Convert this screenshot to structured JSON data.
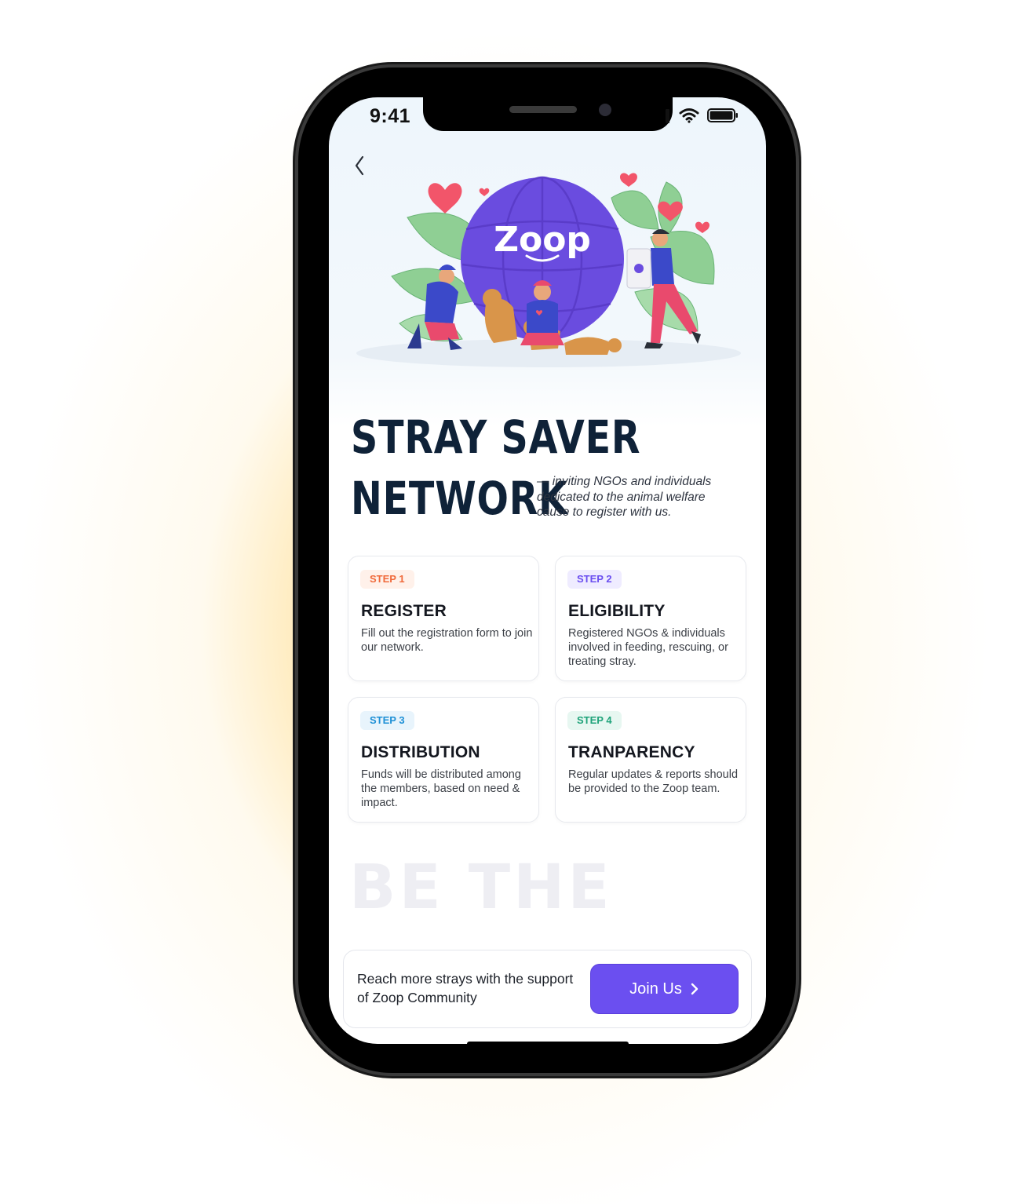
{
  "status_bar": {
    "time": "9:41"
  },
  "hero": {
    "brand_logo": "Zoop"
  },
  "heading": {
    "line1": "STRAY  SAVER",
    "line2": "NETWORK",
    "subtitle": "— inviting NGOs and individuals dedicated to the animal welfare cause to register with us."
  },
  "steps": [
    {
      "badge": "STEP 1",
      "title": "REGISTER",
      "text": "Fill out the registration form to join our network.",
      "badge_color": "#f06a3b",
      "badge_bg": "#fff1ea"
    },
    {
      "badge": "STEP 2",
      "title": "ELIGIBILITY",
      "text": "Registered NGOs & individuals involved in feeding, rescuing, or treating stray.",
      "badge_color": "#6b4ff0",
      "badge_bg": "#efecff"
    },
    {
      "badge": "STEP 3",
      "title": "DISTRIBUTION",
      "text": "Funds will be distributed among the members, based on need & impact.",
      "badge_color": "#1e90d6",
      "badge_bg": "#e8f4fc"
    },
    {
      "badge": "STEP 4",
      "title": "TRANPARENCY",
      "text": "Regular updates & reports should be provided to the Zoop team.",
      "badge_color": "#1fa37a",
      "badge_bg": "#e7f7f1"
    }
  ],
  "background_text": "BE THE",
  "cta": {
    "text": "Reach more strays with the support of Zoop Community",
    "button_label": "Join Us"
  },
  "colors": {
    "accent": "#6b4ff0",
    "heading": "#0f2238",
    "glow": "#ffc440"
  }
}
